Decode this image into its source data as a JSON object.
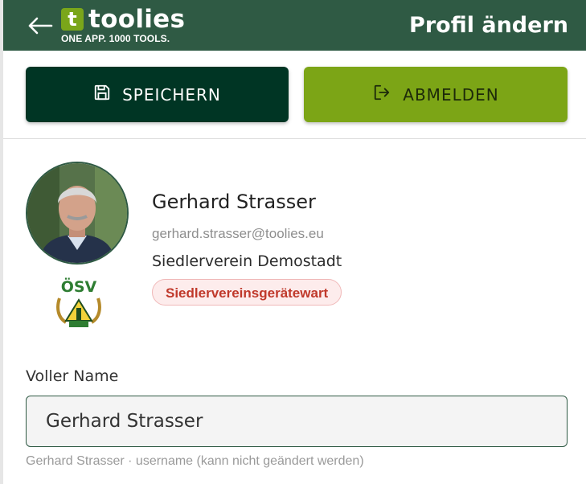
{
  "header": {
    "logo_letter": "t",
    "logo_word": "toolies",
    "logo_tagline": "ONE APP. 1000 TOOLS.",
    "title": "Profil ändern",
    "back_icon": "arrow-left-icon"
  },
  "actions": {
    "save_label": "SPEICHERN",
    "save_icon": "floppy-disk-icon",
    "logout_label": "ABMELDEN",
    "logout_icon": "logout-icon"
  },
  "profile": {
    "name": "Gerhard Strasser",
    "email": "gerhard.strasser@toolies.eu",
    "organization": "Siedlerverein Demostadt",
    "role": "Siedlervereinsgerätewart",
    "club_logo_text": "ÖSV"
  },
  "form": {
    "full_name_label": "Voller Name",
    "full_name_value": "Gerhard Strasser",
    "full_name_hint": "Gerhard Strasser · username (kann nicht geändert werden)"
  },
  "colors": {
    "header_bg": "#2f5a44",
    "save_bg": "#003524",
    "logout_bg": "#7ca516",
    "role_text": "#c0392b"
  }
}
